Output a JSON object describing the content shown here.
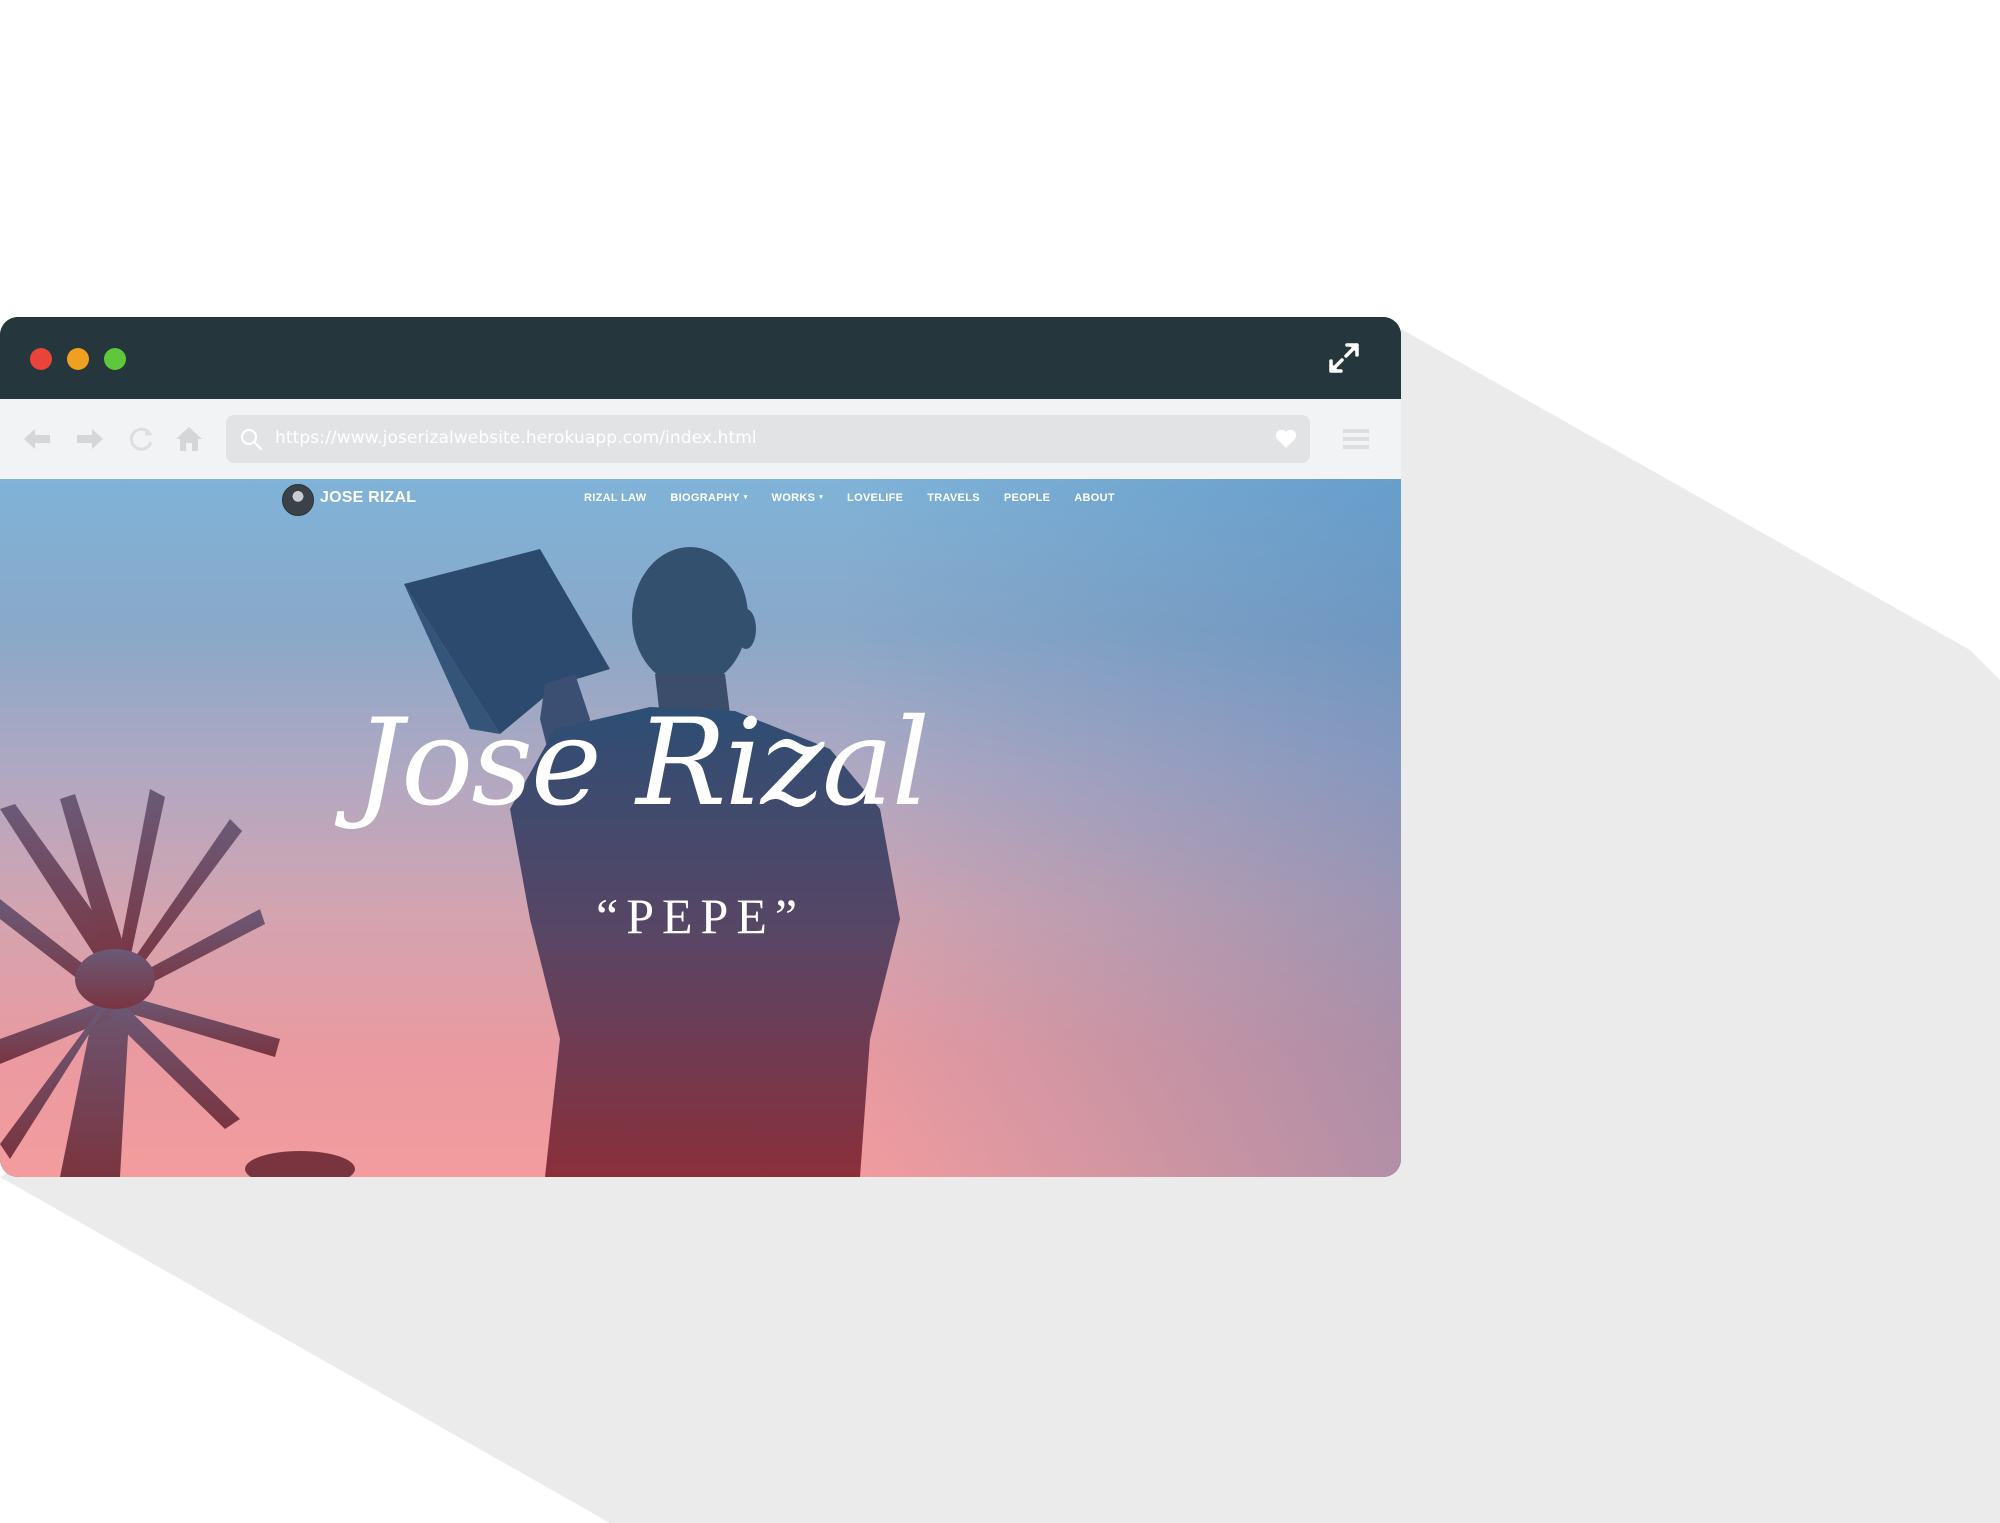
{
  "browser": {
    "url": "https://www.joserizalwebsite.herokuapp.com/index.html"
  },
  "site": {
    "brand": "JOSE RIZAL",
    "nav": [
      {
        "label": "RIZAL LAW"
      },
      {
        "label": "BIOGRAPHY",
        "dropdown": true
      },
      {
        "label": "WORKS",
        "dropdown": true
      },
      {
        "label": "LOVELIFE"
      },
      {
        "label": "TRAVELS"
      },
      {
        "label": "PEOPLE"
      },
      {
        "label": "ABOUT"
      }
    ],
    "caret": "▾"
  },
  "hero": {
    "title": "Jose Rizal",
    "subtitle": "“PEPE”"
  },
  "colors": {
    "titlebar": "#25363c",
    "toolbar": "#f2f3f4",
    "urlbar": "#e1e3e5",
    "close": "#e8443a",
    "minimize": "#f0a020",
    "maximize": "#5fc73a",
    "shadow": "#ebebeb"
  },
  "icons": [
    "back-arrow-icon",
    "forward-arrow-icon",
    "reload-icon",
    "home-icon",
    "search-icon",
    "heart-icon",
    "hamburger-menu-icon",
    "expand-icon"
  ]
}
